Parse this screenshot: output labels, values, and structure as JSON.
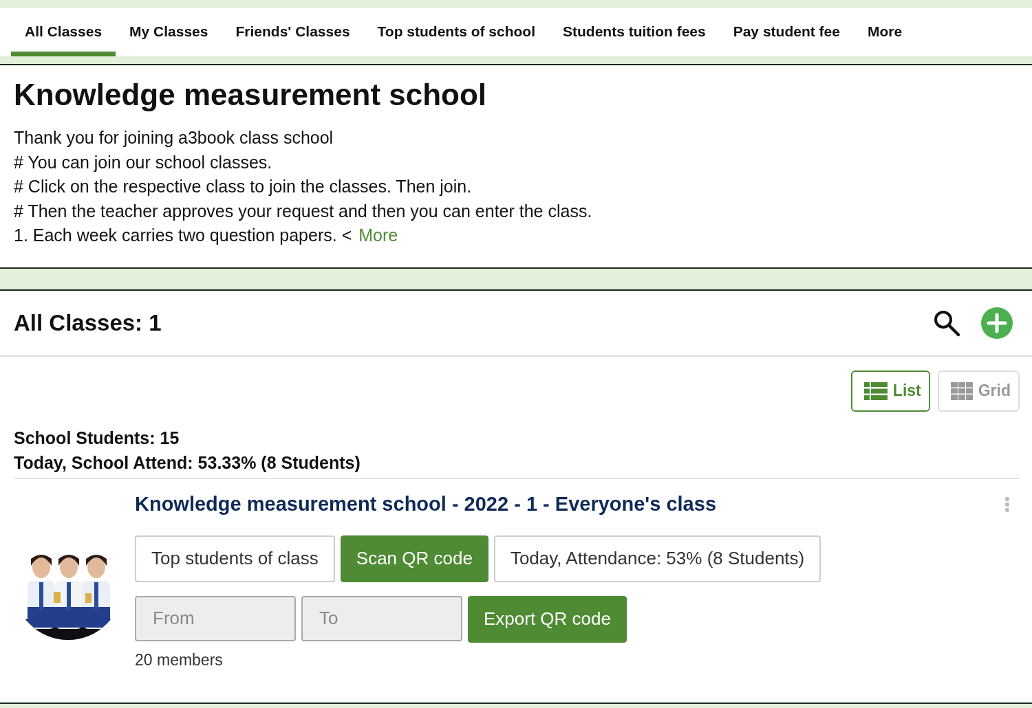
{
  "tabs": [
    {
      "label": "All Classes",
      "selected": true
    },
    {
      "label": "My Classes",
      "selected": false
    },
    {
      "label": "Friends' Classes",
      "selected": false
    },
    {
      "label": "Top students of school",
      "selected": false
    },
    {
      "label": "Students tuition fees",
      "selected": false
    },
    {
      "label": "Pay student fee",
      "selected": false
    },
    {
      "label": "More",
      "selected": false
    }
  ],
  "school": {
    "title": "Knowledge measurement school",
    "description_lines": [
      "Thank you for joining a3book class school",
      "# You can join our school classes.",
      "# Click on the respective class to join the classes. Then join.",
      "# Then the teacher approves your request and then you can enter the class.",
      "1. Each week carries two question papers. <"
    ],
    "more_link": "More"
  },
  "classes_header": {
    "title": "All Classes: 1"
  },
  "view_toggle": [
    {
      "label": "List",
      "kind": "list",
      "selected": true
    },
    {
      "label": "Grid",
      "kind": "grid",
      "selected": false
    }
  ],
  "stats": [
    "School Students: 15",
    "Today, School Attend: 53.33% (8 Students)"
  ],
  "class_card": {
    "title": "Knowledge measurement school - 2022 - 1 - Everyone's class",
    "actions": [
      {
        "label": "Top students of class",
        "kind": "outline"
      },
      {
        "label": "Scan QR code",
        "kind": "primary"
      },
      {
        "label": "Today, Attendance: 53% (8 Students)",
        "kind": "outline"
      }
    ],
    "export_row": [
      {
        "placeholder": "From",
        "kind": "field"
      },
      {
        "placeholder": "To",
        "kind": "field"
      },
      {
        "label": "Export QR code",
        "kind": "primary"
      }
    ],
    "members": "20 members"
  }
}
